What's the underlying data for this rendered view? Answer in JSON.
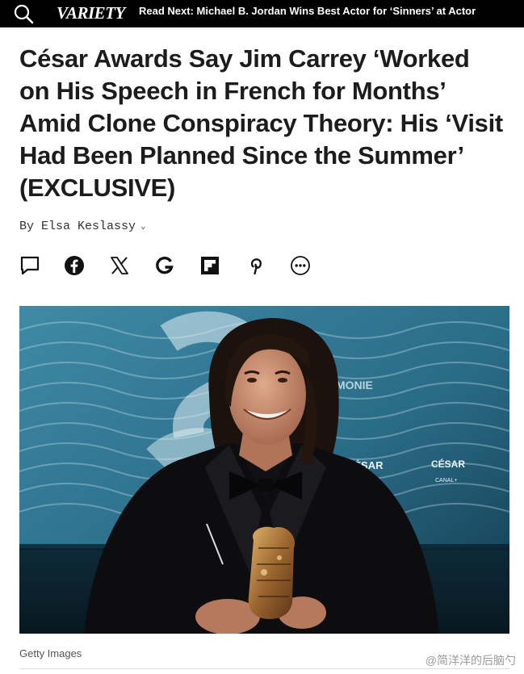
{
  "header": {
    "logo": "VARIETY",
    "read_next": "Read Next: Michael B. Jordan Wins Best Actor for ‘Sinners’ at Actor"
  },
  "article": {
    "headline": "César Awards Say Jim Carrey ‘Worked on His Speech in French for Months’ Amid Clone Conspiracy Theory: His ‘Visit Had Been Planned Since the Summer’ (EXCLUSIVE)",
    "byline": "By Elsa Keslassy",
    "photo_credit": "Getty Images",
    "photo_text": {
      "backdrop_word": "MONIE",
      "logo_left": "CÉSAR",
      "logo_right": "CÉSAR",
      "logo_right_sub": "CANAL+"
    }
  },
  "share_icons": [
    "comment-icon",
    "facebook-icon",
    "x-icon",
    "google-icon",
    "flipboard-icon",
    "pinterest-icon",
    "more-icon"
  ],
  "watermark": "@简洋洋的后脑勺",
  "colors": {
    "topbar": "#000000",
    "photo_bg": "#1b4f66",
    "headline": "#1c1c1c"
  }
}
